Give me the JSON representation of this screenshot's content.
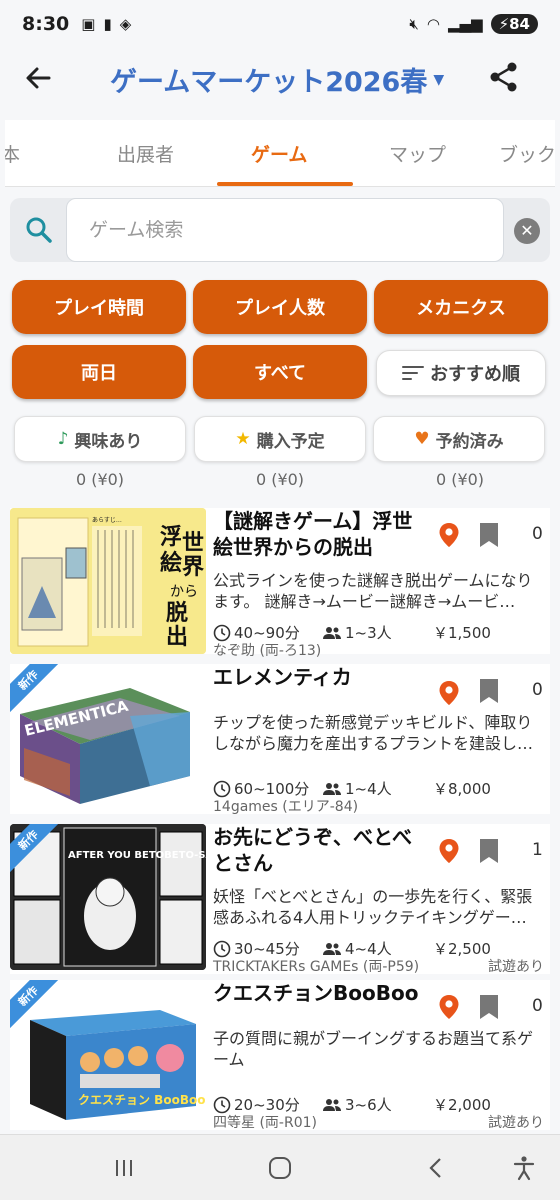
{
  "status_bar": {
    "time": "8:30",
    "battery": "84"
  },
  "app_bar": {
    "title": "ゲームマーケット2026春",
    "title_color": "#3d6fc4"
  },
  "tabs": [
    {
      "label": "本",
      "active": false
    },
    {
      "label": "出展者",
      "active": false
    },
    {
      "label": "ゲーム",
      "active": true
    },
    {
      "label": "マップ",
      "active": false
    },
    {
      "label": "ブック",
      "active": false
    }
  ],
  "search": {
    "placeholder": "ゲーム検索",
    "value": ""
  },
  "filters": {
    "play_time": "プレイ時間",
    "players": "プレイ人数",
    "mechanics": "メカニクス",
    "day": "両日",
    "category": "すべて",
    "sort": "おすすめ順"
  },
  "status_filters": [
    {
      "label": "興味あり",
      "count": "0 (¥0)",
      "icon": "music-note-icon",
      "color": "#2e9a5b"
    },
    {
      "label": "購入予定",
      "count": "0 (¥0)",
      "icon": "star-icon",
      "color": "#f2b800"
    },
    {
      "label": "予約済み",
      "count": "0 (¥0)",
      "icon": "heart-icon",
      "color": "#e8741a"
    }
  ],
  "games": [
    {
      "title": "【謎解きゲーム】浮世絵世界からの脱出",
      "description": "公式ラインを使った謎解き脱出ゲームになります。 謎解き→ムービー謎解き→ムービ…",
      "time": "40~90分",
      "players": "1~3人",
      "price": "￥1,500",
      "booth": "なぞ助 (両-ろ13)",
      "trial": "",
      "likes": "0",
      "new": false
    },
    {
      "title": "エレメンティカ",
      "description": "チップを使った新感覚デッキビルド、陣取りしながら魔力を産出するプラントを建設し…",
      "time": "60~100分",
      "players": "1~4人",
      "price": "￥8,000",
      "booth": "14games (エリア-84)",
      "trial": "",
      "likes": "0",
      "new": true,
      "box_text": "ELEMENTICA"
    },
    {
      "title": "お先にどうぞ、べとべとさん",
      "description": "妖怪「べとべとさん」の一歩先を行く、緊張感あふれる4人用トリックテイキングゲー…",
      "time": "30~45分",
      "players": "4~4人",
      "price": "￥2,500",
      "booth": "TRICKTAKERs GAMEs (両-P59)",
      "trial": "試遊あり",
      "likes": "1",
      "new": true,
      "box_text": "AFTER YOU BETOBETO-SAN"
    },
    {
      "title": "クエスチョンBooBoo",
      "description": "子の質問に親がブーイングするお題当て系ゲーム",
      "time": "20~30分",
      "players": "3~6人",
      "price": "￥2,000",
      "booth": "四等星 (両-R01)",
      "trial": "試遊あり",
      "likes": "0",
      "new": true,
      "box_text": "クエスチョン BooBoo"
    }
  ],
  "badge_new_label": "新作",
  "colors": {
    "accent": "#d65a0a",
    "tab_active": "#e86a12",
    "badge": "#3c8fdc",
    "pin": "#e8541a"
  }
}
